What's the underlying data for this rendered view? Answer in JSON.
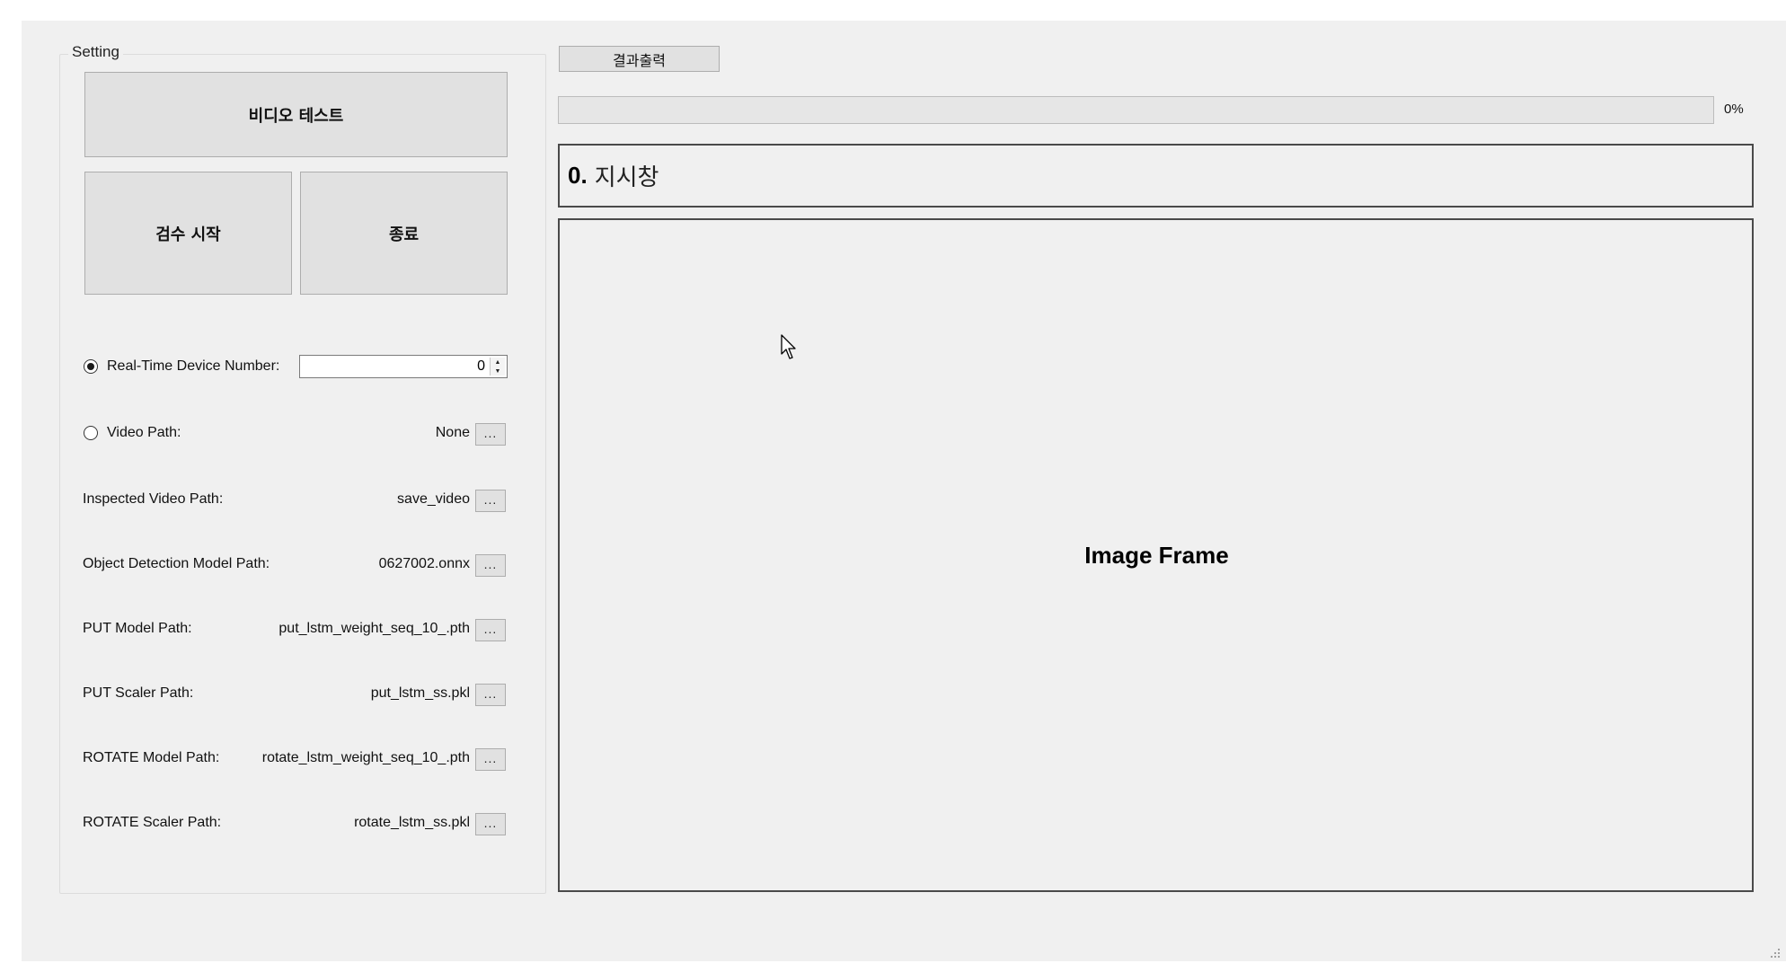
{
  "settings": {
    "title": "Setting",
    "video_test_label": "비디오 테스트",
    "start_label": "검수 시작",
    "exit_label": "종료",
    "realtime": {
      "label": "Real-Time Device Number:",
      "selected": true,
      "value": "0"
    },
    "video_path": {
      "label": "Video Path:",
      "selected": false,
      "value": "None"
    },
    "rows": [
      {
        "label": "Inspected Video Path:",
        "value": "save_video"
      },
      {
        "label": "Object Detection Model Path:",
        "value": "0627002.onnx"
      },
      {
        "label": "PUT Model Path:",
        "value": "put_lstm_weight_seq_10_.pth"
      },
      {
        "label": "PUT Scaler Path:",
        "value": "put_lstm_ss.pkl"
      },
      {
        "label": "ROTATE Model Path:",
        "value": "rotate_lstm_weight_seq_10_.pth"
      },
      {
        "label": "ROTATE Scaler Path:",
        "value": "rotate_lstm_ss.pkl"
      }
    ],
    "browse_label": "..."
  },
  "result_button_label": "결과출력",
  "progress": {
    "value": 0,
    "text": "0%"
  },
  "indicator": {
    "number": "0.",
    "text": "지시창"
  },
  "image_frame": {
    "label": "Image Frame"
  },
  "icons": {
    "cursor": "mouse-pointer-icon",
    "resize": "resize-grip-icon",
    "spin_up": "triangle-up-icon",
    "spin_down": "triangle-down-icon"
  }
}
